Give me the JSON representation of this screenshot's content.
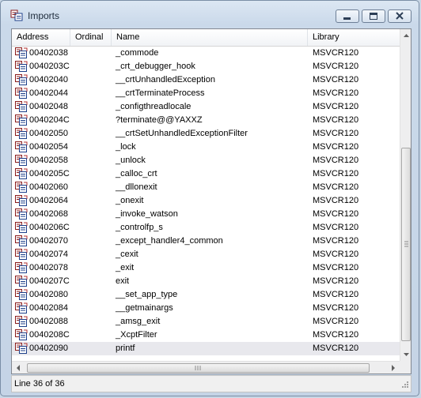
{
  "window": {
    "title": "Imports"
  },
  "columns": {
    "address": "Address",
    "ordinal": "Ordinal",
    "name": "Name",
    "library": "Library"
  },
  "rows": [
    {
      "address": "00402038",
      "ordinal": "",
      "name": "_commode",
      "library": "MSVCR120"
    },
    {
      "address": "0040203C",
      "ordinal": "",
      "name": "_crt_debugger_hook",
      "library": "MSVCR120"
    },
    {
      "address": "00402040",
      "ordinal": "",
      "name": "__crtUnhandledException",
      "library": "MSVCR120"
    },
    {
      "address": "00402044",
      "ordinal": "",
      "name": "__crtTerminateProcess",
      "library": "MSVCR120"
    },
    {
      "address": "00402048",
      "ordinal": "",
      "name": "_configthreadlocale",
      "library": "MSVCR120"
    },
    {
      "address": "0040204C",
      "ordinal": "",
      "name": "?terminate@@YAXXZ",
      "library": "MSVCR120"
    },
    {
      "address": "00402050",
      "ordinal": "",
      "name": "__crtSetUnhandledExceptionFilter",
      "library": "MSVCR120"
    },
    {
      "address": "00402054",
      "ordinal": "",
      "name": "_lock",
      "library": "MSVCR120"
    },
    {
      "address": "00402058",
      "ordinal": "",
      "name": "_unlock",
      "library": "MSVCR120"
    },
    {
      "address": "0040205C",
      "ordinal": "",
      "name": "_calloc_crt",
      "library": "MSVCR120"
    },
    {
      "address": "00402060",
      "ordinal": "",
      "name": "__dllonexit",
      "library": "MSVCR120"
    },
    {
      "address": "00402064",
      "ordinal": "",
      "name": "_onexit",
      "library": "MSVCR120"
    },
    {
      "address": "00402068",
      "ordinal": "",
      "name": "_invoke_watson",
      "library": "MSVCR120"
    },
    {
      "address": "0040206C",
      "ordinal": "",
      "name": "_controlfp_s",
      "library": "MSVCR120"
    },
    {
      "address": "00402070",
      "ordinal": "",
      "name": "_except_handler4_common",
      "library": "MSVCR120"
    },
    {
      "address": "00402074",
      "ordinal": "",
      "name": "_cexit",
      "library": "MSVCR120"
    },
    {
      "address": "00402078",
      "ordinal": "",
      "name": "_exit",
      "library": "MSVCR120"
    },
    {
      "address": "0040207C",
      "ordinal": "",
      "name": "exit",
      "library": "MSVCR120"
    },
    {
      "address": "00402080",
      "ordinal": "",
      "name": "__set_app_type",
      "library": "MSVCR120"
    },
    {
      "address": "00402084",
      "ordinal": "",
      "name": "__getmainargs",
      "library": "MSVCR120"
    },
    {
      "address": "00402088",
      "ordinal": "",
      "name": "_amsg_exit",
      "library": "MSVCR120"
    },
    {
      "address": "0040208C",
      "ordinal": "",
      "name": "_XcptFilter",
      "library": "MSVCR120"
    },
    {
      "address": "00402090",
      "ordinal": "",
      "name": "printf",
      "library": "MSVCR120",
      "selected": true
    }
  ],
  "row_icon": "import-function-icon",
  "status": {
    "text": "Line 36 of 36"
  },
  "scroll": {
    "vertical_position": 1.0
  }
}
